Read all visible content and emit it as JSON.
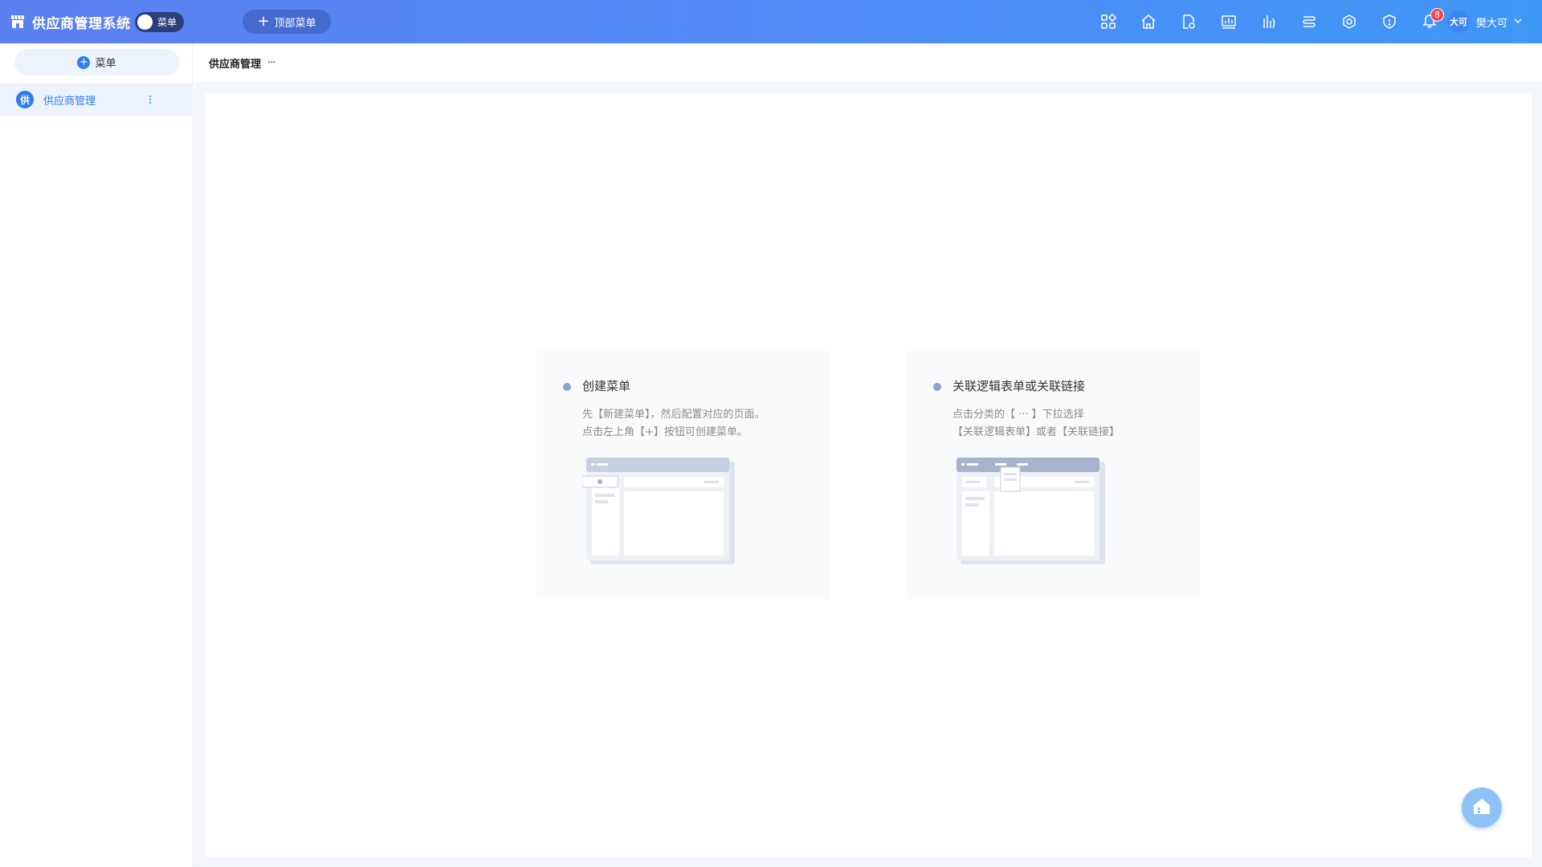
{
  "app": {
    "title": "供应商管理系统",
    "toggle_label": "菜单",
    "top_menu_button": "顶部菜单"
  },
  "topbar": {
    "icons": [
      "apps-icon",
      "home-icon",
      "file-settings-icon",
      "report-icon",
      "chart-icon",
      "data-flow-icon",
      "network-icon",
      "shield-icon",
      "bell-icon"
    ],
    "notification_count": "8",
    "user_avatar_text": "大可",
    "user_name": "樊大可"
  },
  "sidebar": {
    "add_label": "菜单",
    "items": [
      {
        "avatar": "供",
        "label": "供应商管理",
        "selected": true
      }
    ]
  },
  "main": {
    "title": "供应商管理",
    "more": "···"
  },
  "guides": [
    {
      "title": "创建菜单",
      "line1": "先【新建菜单】，然后配置对应的页面。",
      "line2": "点击左上角【+】按钮可创建菜单。"
    },
    {
      "title": "关联逻辑表单或关联链接",
      "line1": "点击分类的【 ··· 】下拉选择",
      "line2": "【关联逻辑表单】或者【关联链接】"
    }
  ],
  "colors": {
    "primary": "#2f7cf0",
    "topbar_start": "#5b7ff0",
    "topbar_end": "#3f97f5",
    "badge": "#f5454f",
    "selected_bg": "#edf3fd"
  }
}
